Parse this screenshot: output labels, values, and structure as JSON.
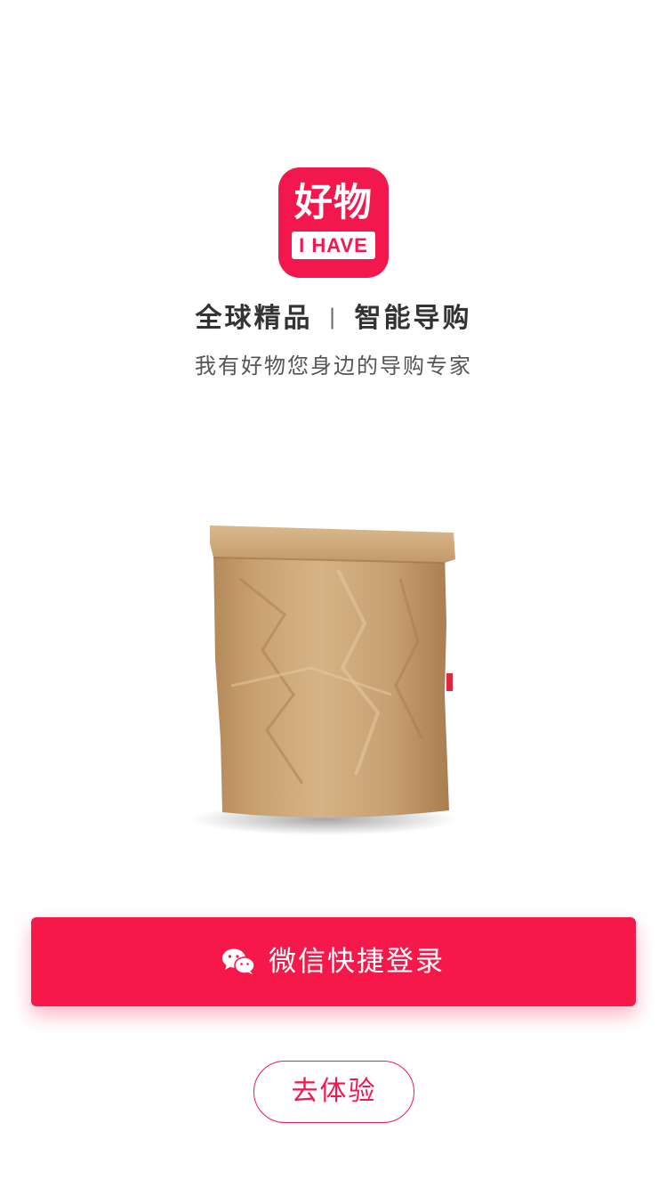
{
  "logo": {
    "text_cn": "好物",
    "text_en": "I HAVE",
    "color": "#f2174c"
  },
  "tagline": {
    "left": "全球精品",
    "separator": "|",
    "right": "智能导购"
  },
  "subtitle": "我有好物您身边的导购专家",
  "hero": {
    "image": "kraft-paper-bag"
  },
  "login_button": {
    "icon": "wechat-icon",
    "label": "微信快捷登录",
    "color": "#f7184a"
  },
  "try_button": {
    "label": "去体验"
  }
}
